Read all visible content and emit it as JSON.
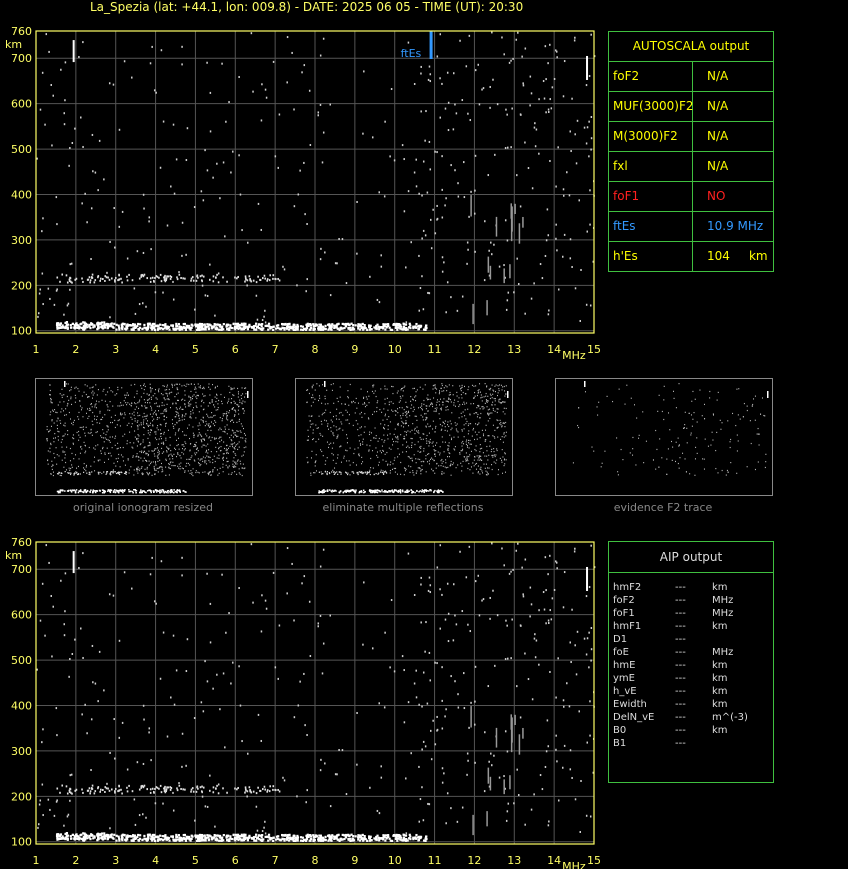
{
  "title": "La_Spezia (lat: +44.1, lon: 009.8) - DATE: 2025 06 05 - TIME (UT): 20:30",
  "autoscala": {
    "header": "AUTOSCALA output",
    "rows": [
      {
        "name": "foF2",
        "value": "N/A",
        "color": "#ffff00"
      },
      {
        "name": "MUF(3000)F2",
        "value": "N/A",
        "color": "#ffff00"
      },
      {
        "name": "M(3000)F2",
        "value": "N/A",
        "color": "#ffff00"
      },
      {
        "name": "fxl",
        "value": "N/A",
        "color": "#ffff00"
      },
      {
        "name": "foF1",
        "value": "NO",
        "color": "#ff2020"
      },
      {
        "name": "ftEs",
        "value": "10.9 MHz",
        "color": "#3399ff"
      },
      {
        "name": "h'Es",
        "value": "104     km",
        "color": "#ffff00"
      }
    ]
  },
  "thumb_captions": [
    "original ionogram resized",
    "eliminate multiple reflections",
    "evidence F2 trace"
  ],
  "aip": {
    "header": "AIP output",
    "rows": [
      {
        "name": "hmF2",
        "dash": "---",
        "unit": "km"
      },
      {
        "name": "foF2",
        "dash": "---",
        "unit": "MHz"
      },
      {
        "name": "foF1",
        "dash": "---",
        "unit": "MHz"
      },
      {
        "name": "hmF1",
        "dash": "---",
        "unit": "km"
      },
      {
        "name": "D1",
        "dash": "---",
        "unit": ""
      },
      {
        "name": "foE",
        "dash": "---",
        "unit": "MHz"
      },
      {
        "name": "hmE",
        "dash": "---",
        "unit": "km"
      },
      {
        "name": "ymE",
        "dash": "---",
        "unit": "km"
      },
      {
        "name": "h_vE",
        "dash": "---",
        "unit": "km"
      },
      {
        "name": "Ewidth",
        "dash": "---",
        "unit": "km"
      },
      {
        "name": "DelN_vE",
        "dash": "---",
        "unit": "m^(-3)"
      },
      {
        "name": "B0",
        "dash": "---",
        "unit": "km"
      },
      {
        "name": "B1",
        "dash": "---",
        "unit": ""
      }
    ]
  },
  "chart_data": [
    {
      "type": "scatter",
      "title": "",
      "xlabel": "MHz",
      "ylabel": "km",
      "xlim": [
        1,
        15
      ],
      "ylim": [
        95,
        760
      ],
      "xticks": [
        1,
        2,
        3,
        4,
        5,
        6,
        7,
        8,
        9,
        10,
        11,
        12,
        13,
        14,
        15
      ],
      "yticks": [
        100,
        200,
        300,
        400,
        500,
        600,
        700,
        760
      ],
      "grid": true,
      "annotation": {
        "text": "ftEs",
        "x": 10.9,
        "color": "#3399ff"
      },
      "series": [
        {
          "values": "Es trace ~100-120 km from 1.5 to 10.8 MHz; F trace ~210-225 km from 1.5 to 7 MHz; scattered noise"
        }
      ]
    },
    {
      "type": "scatter",
      "title": "",
      "xlabel": "MHz",
      "ylabel": "km",
      "xlim": [
        1,
        15
      ],
      "ylim": [
        95,
        760
      ],
      "xticks": [
        1,
        2,
        3,
        4,
        5,
        6,
        7,
        8,
        9,
        10,
        11,
        12,
        13,
        14,
        15
      ],
      "yticks": [
        100,
        200,
        300,
        400,
        500,
        600,
        700,
        760
      ],
      "grid": true
    }
  ]
}
